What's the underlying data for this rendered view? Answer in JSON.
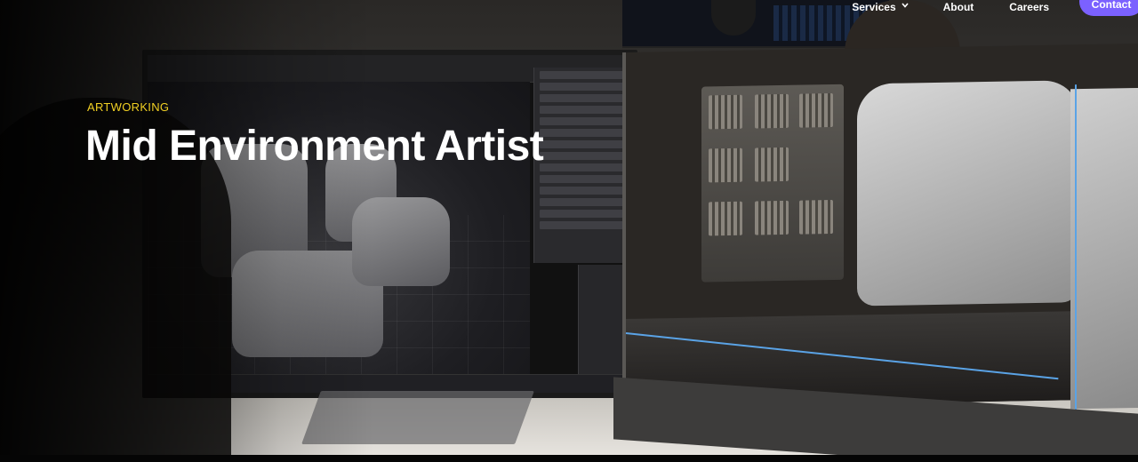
{
  "nav": {
    "items": [
      {
        "label": "Services",
        "has_dropdown": true
      },
      {
        "label": "About",
        "has_dropdown": false
      },
      {
        "label": "Careers",
        "has_dropdown": false
      }
    ],
    "cta_label": "Contact",
    "cta_color": "#7b61ff"
  },
  "hero": {
    "eyebrow": "ARTWORKING",
    "title": "Mid Environment Artist",
    "eyebrow_color": "#f1d023",
    "title_color": "#ffffff"
  },
  "icons": {
    "services_dropdown": "chevron-down-icon"
  }
}
